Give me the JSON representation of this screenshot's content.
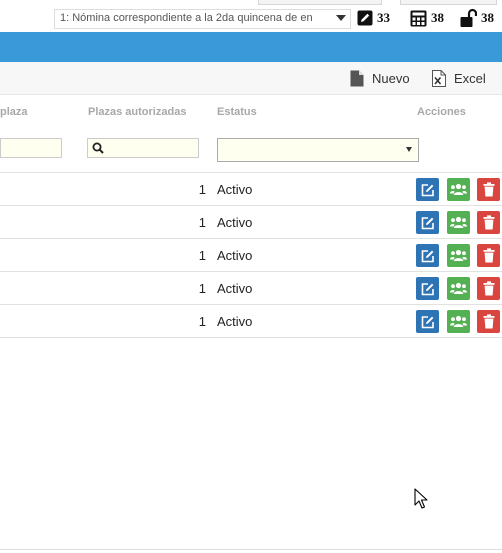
{
  "topbar": {
    "nomina_selected": "1: Nómina correspondiente a la 2da quincena de en",
    "counters": [
      {
        "icon": "pencil-icon",
        "value": "33"
      },
      {
        "icon": "calculator-icon",
        "value": "38"
      },
      {
        "icon": "unlock-icon",
        "value": "38"
      }
    ]
  },
  "toolbar": {
    "nuevo_label": "Nuevo",
    "excel_label": "Excel"
  },
  "table": {
    "headers": {
      "plaza": "plaza",
      "plazas_autorizadas": "Plazas autorizadas",
      "estatus": "Estatus",
      "acciones": "Acciones"
    },
    "filters": {
      "plazas_autorizadas_value": "",
      "estatus_selected": ""
    },
    "rows": [
      {
        "plazas": "1",
        "estatus": "Activo"
      },
      {
        "plazas": "1",
        "estatus": "Activo"
      },
      {
        "plazas": "1",
        "estatus": "Activo"
      },
      {
        "plazas": "1",
        "estatus": "Activo"
      },
      {
        "plazas": "1",
        "estatus": "Activo"
      }
    ]
  },
  "colors": {
    "header_bar": "#3a9ad9",
    "edit_button": "#2e74b5",
    "group_button": "#53b153",
    "delete_button": "#d9463f"
  }
}
